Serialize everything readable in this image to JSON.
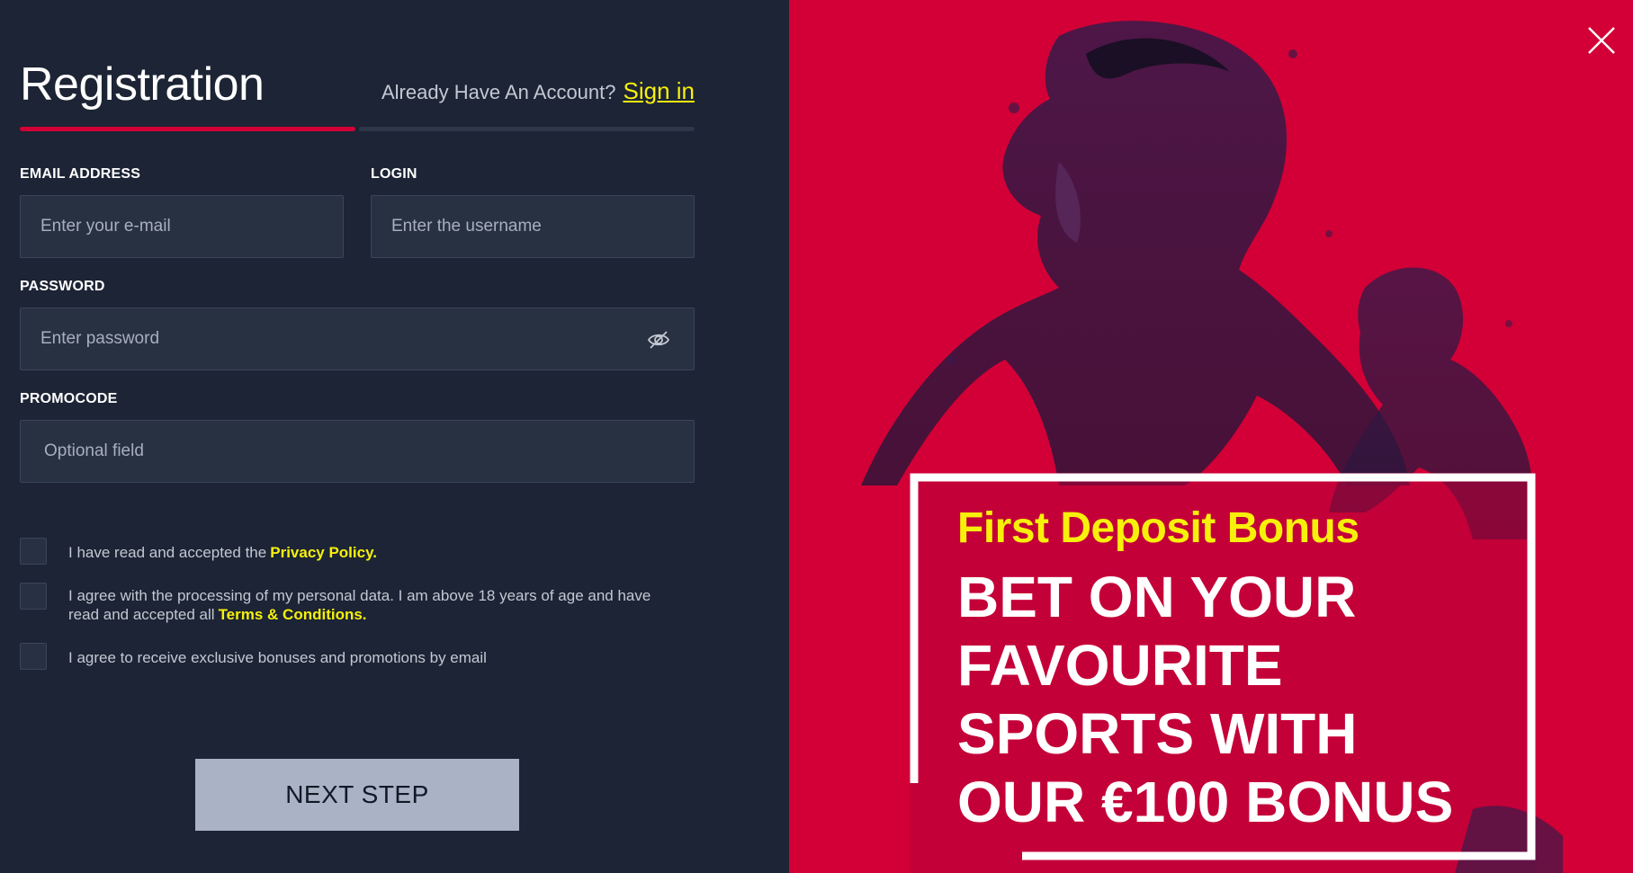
{
  "form": {
    "title": "Registration",
    "already_text": "Already Have An Account?",
    "signin_label": "Sign in",
    "email_label": "EMAIL ADDRESS",
    "email_placeholder": "Enter your e-mail",
    "login_label": "LOGIN",
    "login_placeholder": "Enter the username",
    "password_label": "PASSWORD",
    "password_placeholder": "Enter password",
    "promocode_label": "PROMOCODE",
    "promocode_placeholder": "Optional field",
    "step_progress": 0.5
  },
  "checkboxes": {
    "privacy_text": "I have read and accepted the",
    "privacy_link": "Privacy Policy.",
    "terms_text": "I agree with the processing of my personal data. I am above 18 years of age and have read and accepted all",
    "terms_link": "Terms & Conditions.",
    "bonus_text": "I agree to receive exclusive bonuses and promotions by email"
  },
  "actions": {
    "next_label": "NEXT STEP"
  },
  "promo": {
    "subtitle": "First Deposit Bonus",
    "headline": "BET ON YOUR FAVOURITE SPORTS WITH OUR €100 BONUS"
  },
  "icons": {
    "password_toggle": "eye-off-icon",
    "close": "close-icon"
  },
  "colors": {
    "accent": "#d20036",
    "highlight": "#f7f00b",
    "panel": "#1c2435",
    "field": "#283142",
    "button": "#a9b3c5"
  }
}
